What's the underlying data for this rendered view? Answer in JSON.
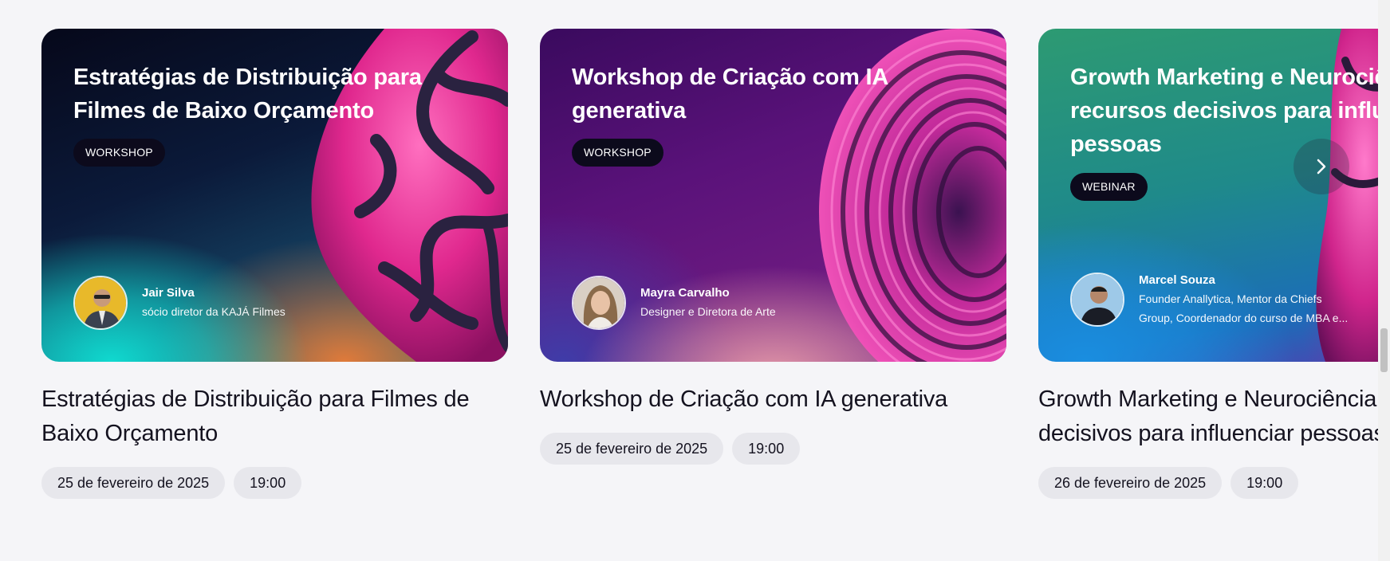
{
  "cards": [
    {
      "banner_title": "Estratégias de Distribuição para Filmes de Baixo Orçamento",
      "tag": "WORKSHOP",
      "speaker": {
        "name": "Jair Silva",
        "role": "sócio diretor da KAJÁ Filmes"
      },
      "title": "Estratégias de Distribuição para Filmes de Baixo Orçamento",
      "date": "25 de fevereiro de 2025",
      "time": "19:00"
    },
    {
      "banner_title": "Workshop de Criação com IA generativa",
      "tag": "WORKSHOP",
      "speaker": {
        "name": "Mayra Carvalho",
        "role": "Designer e Diretora de Arte"
      },
      "title": "Workshop de Criação com IA generativa",
      "date": "25 de fevereiro de 2025",
      "time": "19:00"
    },
    {
      "banner_title": "Growth Marketing e Neurociência: recursos decisivos para influenciar pessoas",
      "tag": "WEBINAR",
      "speaker": {
        "name": "Marcel Souza",
        "role_line1": "Founder Anallytica, Mentor da Chiefs",
        "role_line2": "Group, Coordenador do curso de MBA e..."
      },
      "title": "Growth Marketing e Neurociência: recursos decisivos para influenciar pessoas",
      "date": "26 de fevereiro de 2025",
      "time": "19:00"
    }
  ],
  "icons": {
    "next": "chevron-right-icon"
  },
  "colors": {
    "background": "#f5f5f8",
    "tag_bg": "#0c0a1c",
    "chip_bg": "#e7e7ec",
    "text": "#14121f"
  }
}
